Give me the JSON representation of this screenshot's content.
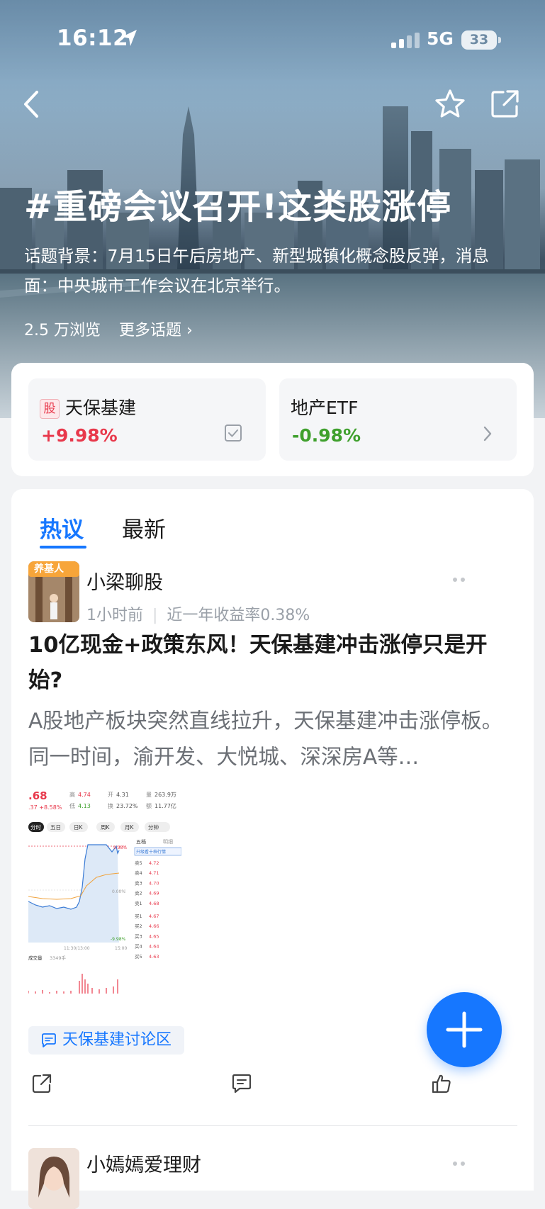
{
  "status_bar": {
    "time": "16:12",
    "network": "5G",
    "battery": "33"
  },
  "header": {
    "topic_title": "#重磅会议召开!这类股涨停",
    "description": "话题背景：7月15日午后房地产、新型城镇化概念股反弹，消息面：中央城市工作会议在北京举行。",
    "views": "2.5 万浏览",
    "more_topics": "更多话题",
    "more_topics_chevron": "›"
  },
  "stocks": [
    {
      "badge": "股",
      "name": "天保基建",
      "change": "+9.98%",
      "color": "#e8384b",
      "action_icon": "checkbox-icon"
    },
    {
      "name": "地产ETF",
      "change": "-0.98%",
      "color": "#3fa02d",
      "action_icon": "chevron-right-icon"
    }
  ],
  "tabs": [
    {
      "label": "热议",
      "active": true
    },
    {
      "label": "最新",
      "active": false
    }
  ],
  "posts": [
    {
      "author": "小梁聊股",
      "avatar_badge": "养基人",
      "time": "1小时前",
      "return_text": "近一年收益率0.38%",
      "title": "10亿现金+政策东风！天保基建冲击涨停只是开始?",
      "excerpt": "A股地产板块突然直线拉升，天保基建冲击涨停板。同一时间，渝开发、大悦城、深深房A等…",
      "image": {
        "price_head": ".68",
        "change_head": ".37  +8.58%",
        "high_label": "高",
        "high": "4.74",
        "low_label": "低",
        "low": "4.13",
        "open_label": "开",
        "open": "4.31",
        "turnover_label": "换",
        "turnover": "23.72%",
        "vol_label": "量",
        "vol": "263.9万",
        "amt_label": "额",
        "amt": "11.77亿",
        "periods": [
          "分时",
          "五日",
          "日K",
          "周K",
          "月K",
          "分钟"
        ],
        "side_tabs": [
          "五档",
          "明细"
        ],
        "upgrade_label": "升级看十档行情",
        "top_pct": "9.98%",
        "mid_pct": "0.00%",
        "bottom_pct": "-9.98%",
        "time_labels": [
          "11:30/13:00",
          "15:00"
        ],
        "volume_label": "成交量",
        "volume_value": "3349手",
        "asks": [
          {
            "label": "卖5",
            "price": "4.72"
          },
          {
            "label": "卖4",
            "price": "4.71"
          },
          {
            "label": "卖3",
            "price": "4.70"
          },
          {
            "label": "卖2",
            "price": "4.69"
          },
          {
            "label": "卖1",
            "price": "4.68"
          }
        ],
        "bids": [
          {
            "label": "买1",
            "price": "4.67"
          },
          {
            "label": "买2",
            "price": "4.66"
          },
          {
            "label": "买3",
            "price": "4.65"
          },
          {
            "label": "买4",
            "price": "4.64"
          },
          {
            "label": "买5",
            "price": "4.63"
          }
        ]
      },
      "forum_tag": "天保基建讨论区"
    },
    {
      "author": "小嫣嫣爱理财"
    }
  ],
  "colors": {
    "accent": "#1677ff",
    "up": "#e8384b",
    "down": "#3fa02d"
  }
}
